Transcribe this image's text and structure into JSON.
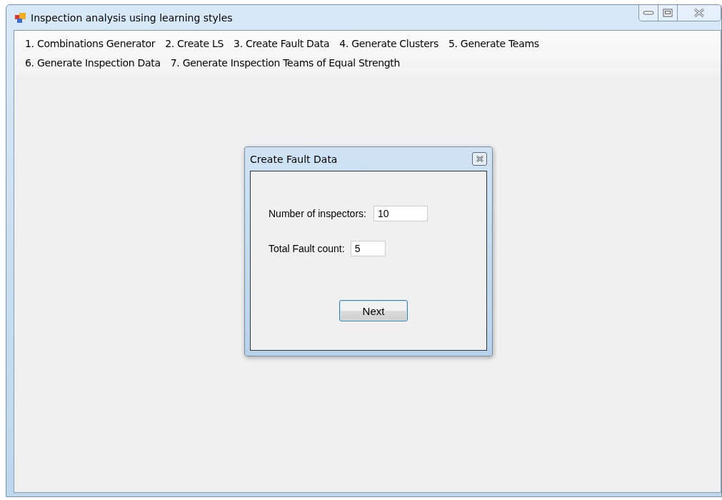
{
  "window": {
    "title": "Inspection analysis using learning styles"
  },
  "menu": [
    [
      {
        "label": "1. Combinations Generator"
      },
      {
        "label": "2. Create LS"
      },
      {
        "label": "3. Create Fault Data"
      },
      {
        "label": "4. Generate Clusters"
      },
      {
        "label": "5. Generate Teams"
      }
    ],
    [
      {
        "label": "6. Generate Inspection Data"
      },
      {
        "label": "7. Generate Inspection Teams of Equal Strength"
      }
    ]
  ],
  "dialog": {
    "title": "Create Fault Data",
    "fields": [
      {
        "label": "Number of inspectors:",
        "value": "10"
      },
      {
        "label": "Total Fault count:",
        "value": "5"
      }
    ],
    "button": "Next"
  }
}
